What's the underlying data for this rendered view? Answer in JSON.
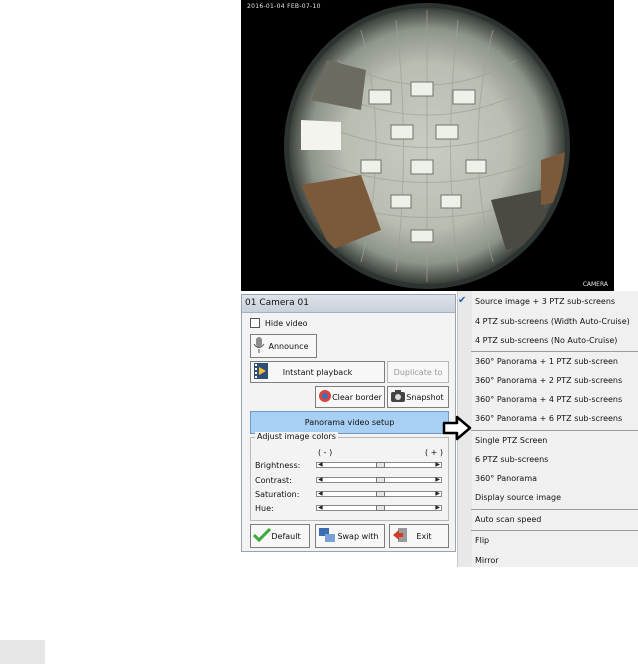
{
  "video": {
    "osd_timestamp": "2016-01-04  FEB-07-10",
    "osd_label": "CAMERA"
  },
  "panel": {
    "title": "01 Camera 01",
    "hide_video_label": "Hide video",
    "announce_label": "Announce",
    "instant_playback_label": "Intstant playback",
    "duplicate_to_label": "Duplicate to",
    "clear_border_label": "Clear border",
    "snapshot_label": "Snapshot",
    "panorama_setup_label": "Panorama video setup",
    "adjust_group_label": "Adjust image colors",
    "minus_label": "( - )",
    "plus_label": "( + )",
    "sliders": [
      {
        "label": "Brightness:",
        "value": 0.5
      },
      {
        "label": "Contrast:",
        "value": 0.5
      },
      {
        "label": "Saturation:",
        "value": 0.5
      },
      {
        "label": "Hue:",
        "value": 0.5
      }
    ],
    "default_label": "Default",
    "swap_with_label": "Swap with",
    "exit_label": "Exit"
  },
  "menu": {
    "items": [
      {
        "label": "Source image + 3 PTZ sub-screens",
        "checked": true
      },
      {
        "label": "4 PTZ sub-screens (Width Auto-Cruise)"
      },
      {
        "label": "4 PTZ sub-screens (No Auto-Cruise)"
      },
      {
        "label": "360° Panorama + 1 PTZ sub-screen"
      },
      {
        "label": "360° Panorama + 2 PTZ sub-screens"
      },
      {
        "label": "360° Panorama + 4 PTZ sub-screens"
      },
      {
        "label": "360° Panorama + 6 PTZ sub-screens"
      },
      {
        "label": "Single PTZ Screen"
      },
      {
        "label": "6 PTZ sub-screens"
      },
      {
        "label": "360° Panorama"
      },
      {
        "label": "Display source image"
      },
      {
        "label": "Auto scan speed"
      },
      {
        "label": "Flip"
      },
      {
        "label": "Mirror"
      }
    ],
    "check_glyph": "✔"
  },
  "colors": {
    "accent_button": "#a8cff4",
    "check": "#2a62a8"
  }
}
